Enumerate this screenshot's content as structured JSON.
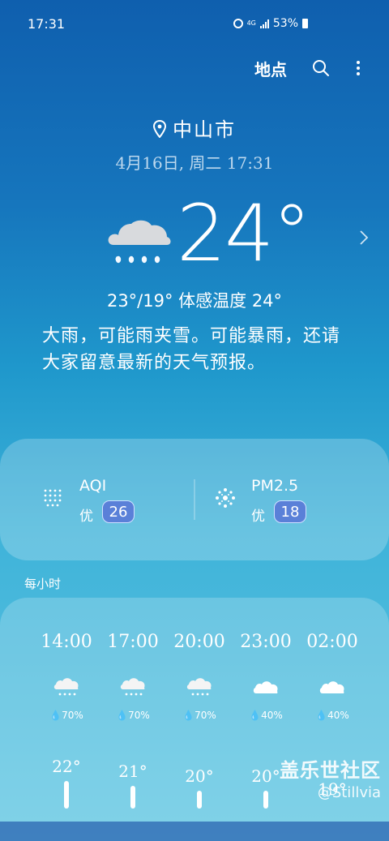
{
  "status_bar": {
    "time": "17:31",
    "network": "4G",
    "battery": "53%"
  },
  "toolbar": {
    "locations_label": "地点"
  },
  "location": {
    "city": "中山市",
    "datetime": "4月16日, 周二 17:31"
  },
  "current": {
    "temperature": "24°",
    "range_feels": "23°/19° 体感温度 24°",
    "description": "大雨，可能雨夹雪。可能暴雨，还请大家留意最新的天气预报。",
    "icon": "rain-cloud-icon"
  },
  "air_quality": {
    "aqi": {
      "label": "AQI",
      "grade": "优",
      "value": "26"
    },
    "pm25": {
      "label": "PM2.5",
      "grade": "优",
      "value": "18"
    }
  },
  "hourly": {
    "title": "每小时",
    "items": [
      {
        "time": "14:00",
        "icon": "rain-cloud-icon",
        "precip": "70%",
        "temp": "22°"
      },
      {
        "time": "17:00",
        "icon": "rain-cloud-icon",
        "precip": "70%",
        "temp": "21°"
      },
      {
        "time": "20:00",
        "icon": "rain-cloud-icon",
        "precip": "70%",
        "temp": "20°"
      },
      {
        "time": "23:00",
        "icon": "cloud-icon",
        "precip": "40%",
        "temp": "20°"
      },
      {
        "time": "02:00",
        "icon": "cloud-icon",
        "precip": "40%",
        "temp": "19°"
      }
    ]
  },
  "watermark": {
    "line1": "盖乐世社区",
    "line2": "@Stillvia"
  }
}
